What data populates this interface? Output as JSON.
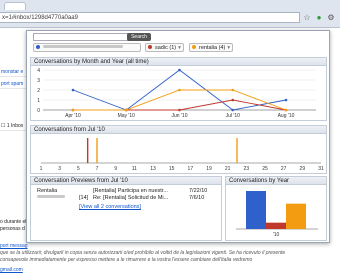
{
  "browser": {
    "url_text": "x=1#inbox/1298d4770a0aa9"
  },
  "popup": {
    "search": {
      "button_label": "Search"
    },
    "chips": [
      {
        "color": "#3060c9",
        "label": "",
        "count": "",
        "blurred": true
      },
      {
        "color": "#c0392b",
        "label": "sadic",
        "count": "(1)"
      },
      {
        "color": "#f39c12",
        "label": "rentalia",
        "count": "(4)"
      }
    ],
    "month_chart": {
      "title": "Conversations by Month and Year (all time)",
      "y_ticks": [
        "0",
        "1",
        "2",
        "3",
        "4"
      ],
      "x_ticks": [
        "Apr '10",
        "May '10",
        "Jun '10",
        "Jul '10",
        "Aug '10"
      ]
    },
    "day_chart": {
      "title": "Conversations from Jul '10",
      "x_ticks": [
        "1",
        "3",
        "5",
        "7",
        "9",
        "11",
        "13",
        "15",
        "17",
        "19",
        "21",
        "23",
        "25",
        "27",
        "29",
        "31"
      ]
    },
    "previews": {
      "title": "Conversation Previews from Jul '10",
      "rows": [
        {
          "from": "Rentalia",
          "count": "",
          "subject": "[Rentalia] Participa en nuestr...",
          "date": "7/22/10"
        },
        {
          "from": "",
          "count": "[14]",
          "subject": "Re: [Rentalia] Solicitud de Mi...",
          "date": "7/6/10"
        }
      ],
      "view_all": "[View all 2 conversations]"
    },
    "year_chart": {
      "title": "Conversations by Year",
      "x_label": "'10"
    }
  },
  "chart_data": [
    {
      "type": "line",
      "title": "Conversations by Month and Year (all time)",
      "categories": [
        "Apr '10",
        "May '10",
        "Jun '10",
        "Jul '10",
        "Aug '10"
      ],
      "ylim": [
        0,
        4
      ],
      "series": [
        {
          "color": "#3060c9",
          "values": [
            2,
            0,
            4,
            0,
            1
          ]
        },
        {
          "color": "#c0392b",
          "values": [
            0,
            0,
            0,
            1,
            0
          ]
        },
        {
          "color": "#f39c12",
          "values": [
            0,
            0,
            2,
            2,
            0
          ]
        }
      ]
    },
    {
      "type": "bar",
      "title": "Conversations from Jul '10",
      "x_range": [
        1,
        31
      ],
      "bars": [
        {
          "day": 6,
          "color": "#c0392b"
        },
        {
          "day": 7,
          "color": "#f39c12"
        },
        {
          "day": 22,
          "color": "#f39c12"
        }
      ]
    },
    {
      "type": "bar",
      "title": "Conversations by Year",
      "categories": [
        "'10"
      ],
      "ylim": [
        0,
        6
      ],
      "series": [
        {
          "color": "#3060c9",
          "values": [
            6
          ]
        },
        {
          "color": "#c0392b",
          "values": [
            1
          ]
        },
        {
          "color": "#f39c12",
          "values": [
            4
          ]
        }
      ]
    }
  ],
  "background": {
    "left_rows": [
      "monstar e",
      "port spam",
      "Inbox"
    ],
    "left_texts": [
      "o durante el",
      "personas d"
    ],
    "bottom_lines": [
      "port messag",
      "que se la utilizzarii; divulgarli in copia senza autorizzarii o/ed prohibilo al voltid de la legislazioni vigenti. Se ha ricevuto il presente",
      "consapevole immediatamente per espresso mettere a le rimarrere e la vostra l'essere cambiare dell'italia vedremo",
      "gmail.com"
    ]
  }
}
